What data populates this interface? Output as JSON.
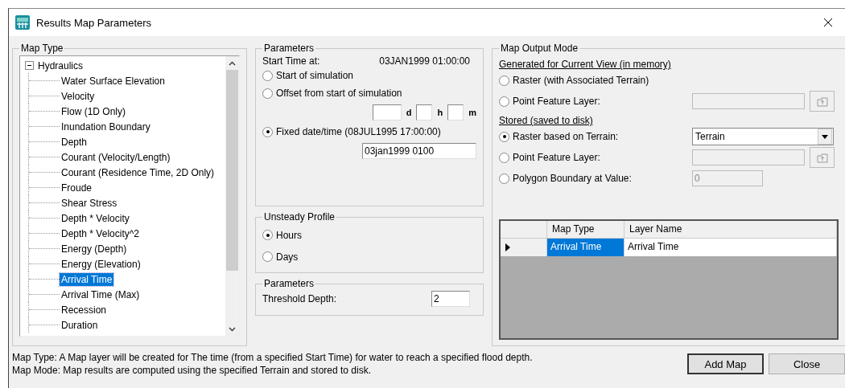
{
  "window": {
    "title": "Results Map Parameters"
  },
  "map_type": {
    "label": "Map Type",
    "tree": {
      "label": "Hydraulics",
      "expanded": true,
      "children": [
        {
          "label": "Water Surface Elevation",
          "selected": false
        },
        {
          "label": "Velocity",
          "selected": false
        },
        {
          "label": "Flow (1D Only)",
          "selected": false
        },
        {
          "label": "Inundation Boundary",
          "selected": false
        },
        {
          "label": "Depth",
          "selected": false
        },
        {
          "label": "Courant (Velocity/Length)",
          "selected": false
        },
        {
          "label": "Courant (Residence Time, 2D Only)",
          "selected": false
        },
        {
          "label": "Froude",
          "selected": false
        },
        {
          "label": "Shear Stress",
          "selected": false
        },
        {
          "label": "Depth * Velocity",
          "selected": false
        },
        {
          "label": "Depth * Velocity^2",
          "selected": false
        },
        {
          "label": "Energy (Depth)",
          "selected": false
        },
        {
          "label": "Energy (Elevation)",
          "selected": false
        },
        {
          "label": "Arrival Time",
          "selected": true
        },
        {
          "label": "Arrival Time (Max)",
          "selected": false
        },
        {
          "label": "Recession",
          "selected": false
        },
        {
          "label": "Duration",
          "selected": false
        }
      ]
    }
  },
  "parameters": {
    "label": "Parameters",
    "start_time_label": "Start Time at:",
    "start_time_value": "03JAN1999 01:00:00",
    "options": [
      {
        "kind": "plain",
        "label": "Start of simulation",
        "selected": false
      },
      {
        "kind": "offset",
        "label": "Offset from start of simulation",
        "selected": false,
        "units": [
          "d",
          "h",
          "m"
        ]
      },
      {
        "kind": "field",
        "label": "Fixed date/time (08JUL1995 17:00:00)",
        "selected": true,
        "value": "03jan1999 0100"
      }
    ]
  },
  "unsteady_profile": {
    "label": "Unsteady Profile",
    "options": [
      {
        "label": "Hours",
        "selected": true
      },
      {
        "label": "Days",
        "selected": false
      }
    ]
  },
  "threshold": {
    "label": "Parameters",
    "field_label": "Threshold Depth:",
    "value": "2"
  },
  "output_mode": {
    "label": "Map Output Mode",
    "sections": [
      {
        "heading": "Generated for Current View (in memory)",
        "options": [
          {
            "kind": "plain",
            "label": "Raster (with Associated Terrain)",
            "selected": false
          },
          {
            "kind": "browse",
            "label": "Point Feature Layer:",
            "selected": false,
            "disabled": true
          }
        ]
      },
      {
        "heading": "Stored (saved to disk)",
        "options": [
          {
            "kind": "dropdown",
            "label": "Raster based on Terrain:",
            "selected": true,
            "value": "Terrain"
          },
          {
            "kind": "browse",
            "label": "Point Feature Layer:",
            "selected": false,
            "disabled": true
          },
          {
            "kind": "short",
            "label": "Polygon Boundary at Value:",
            "selected": false,
            "disabled": true,
            "value": "0"
          }
        ]
      }
    ]
  },
  "table": {
    "columns": [
      "Map Type",
      "Layer Name"
    ],
    "rows": [
      {
        "current": true,
        "cells": [
          {
            "text": "Arrival Time",
            "selected": true
          },
          {
            "text": "Arrival Time",
            "selected": false
          }
        ]
      }
    ]
  },
  "description": [
    "Map Type: A Map layer will be created for The time (from a specified Start Time) for water to reach a specified flood depth.",
    "Map Mode: Map results are computed using the specified Terrain and stored to disk."
  ],
  "buttons": [
    {
      "label": "Add Map",
      "default": true
    },
    {
      "label": "Close",
      "default": false
    }
  ]
}
